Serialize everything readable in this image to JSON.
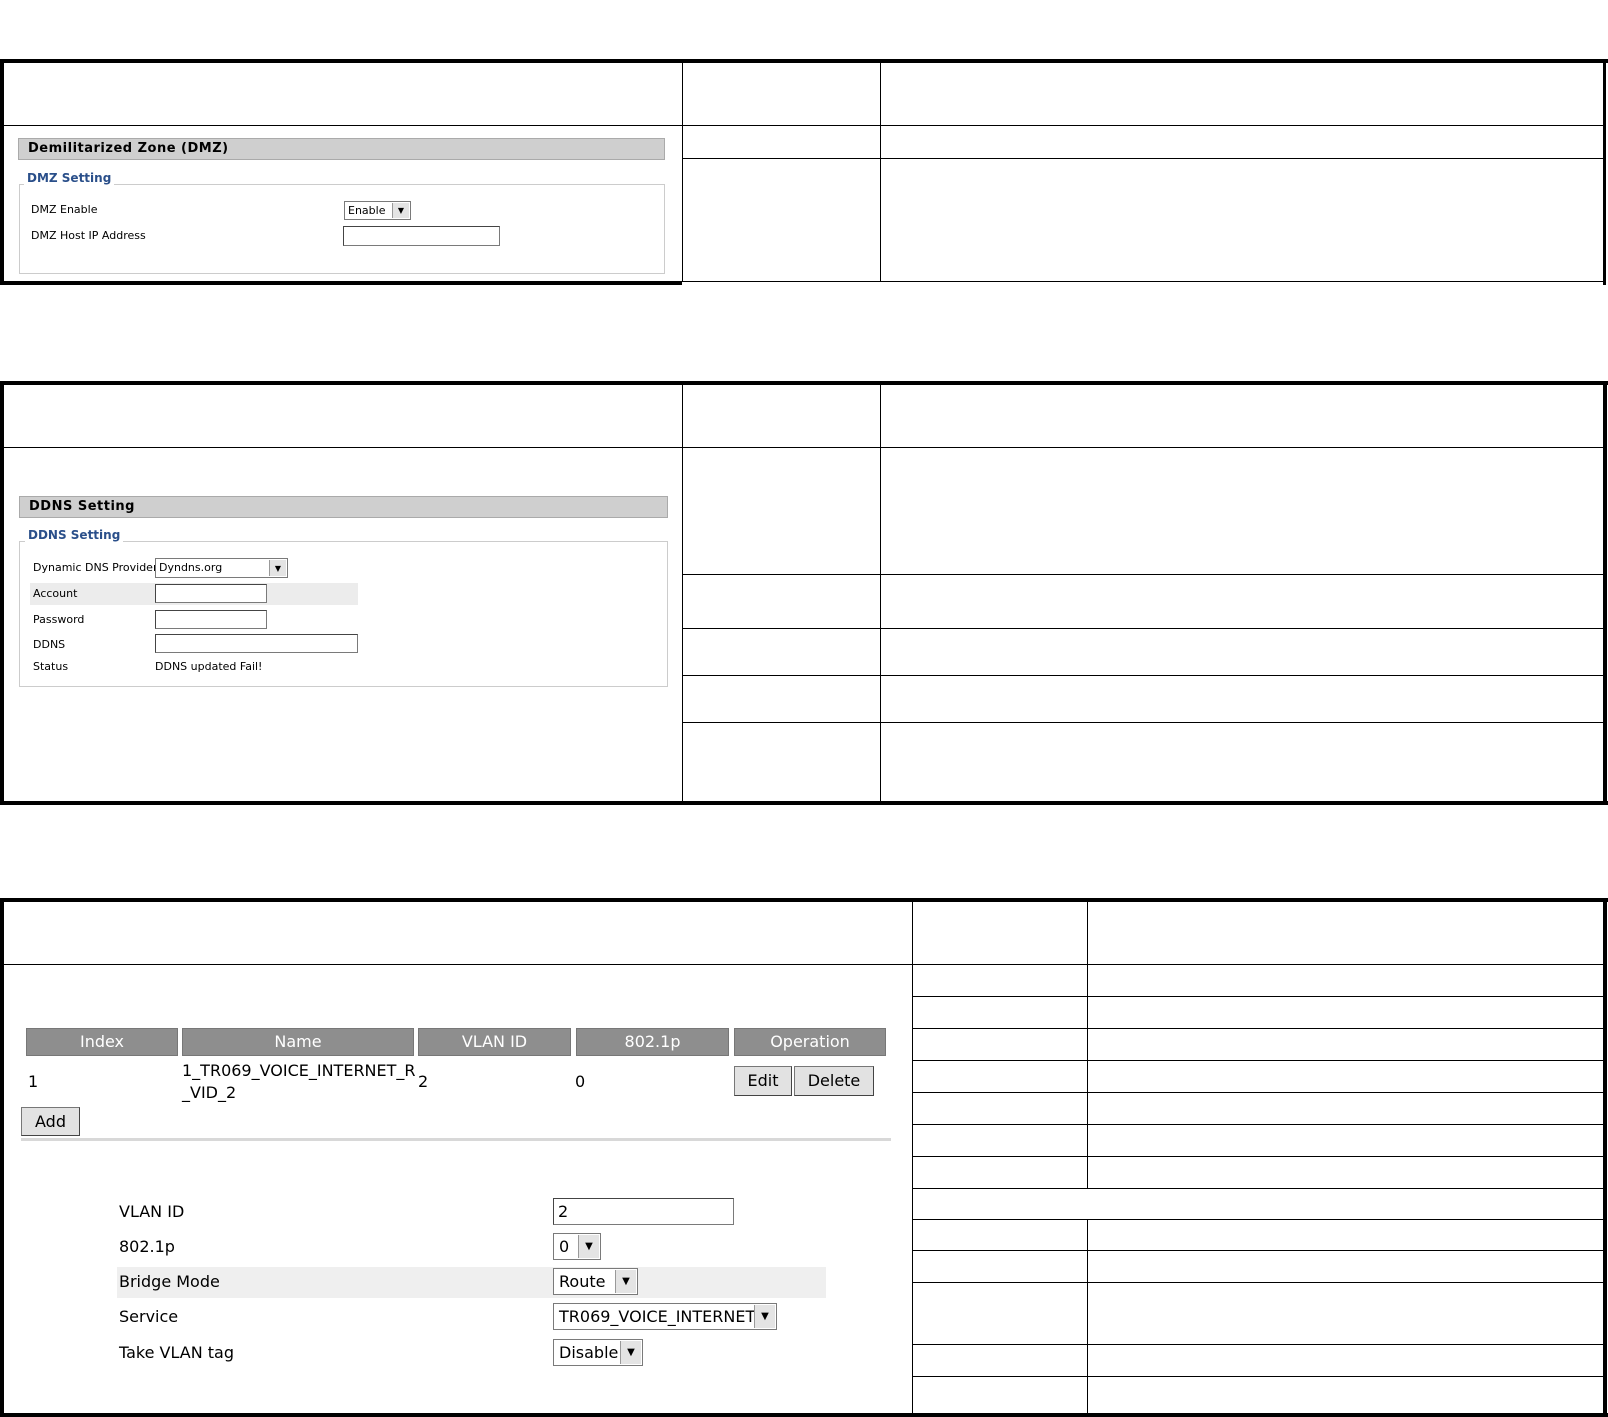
{
  "dmz": {
    "section_title": "Demilitarized Zone (DMZ)",
    "legend": "DMZ Setting",
    "enable_label": "DMZ Enable",
    "enable_value": "Enable",
    "host_ip_label": "DMZ Host IP Address",
    "host_ip_value": ""
  },
  "ddns": {
    "section_title": "DDNS Setting",
    "legend": "DDNS Setting",
    "provider_label": "Dynamic DNS Provider",
    "provider_value": "Dyndns.org",
    "account_label": "Account",
    "account_value": "",
    "password_label": "Password",
    "password_value": "",
    "ddns_label": "DDNS",
    "ddns_value": "",
    "status_label": "Status",
    "status_value": "DDNS updated Fail!"
  },
  "vlan": {
    "headers": [
      "Index",
      "Name",
      "VLAN ID",
      "802.1p",
      "Operation"
    ],
    "row": {
      "index": "1",
      "name_line1": "1_TR069_VOICE_INTERNET_R",
      "name_line2": "_VID_2",
      "vlan_id": "2",
      "p8021": "0",
      "edit_label": "Edit",
      "delete_label": "Delete"
    },
    "add_label": "Add",
    "form": {
      "vlan_id_label": "VLAN ID",
      "vlan_id_value": "2",
      "p8021_label": "802.1p",
      "p8021_value": "0",
      "bridge_mode_label": "Bridge Mode",
      "bridge_mode_value": "Route",
      "service_label": "Service",
      "service_value": "TR069_VOICE_INTERNET",
      "take_vlan_tag_label": "Take VLAN tag",
      "take_vlan_tag_value": "Disable"
    }
  },
  "icons": {
    "dropdown": "chevron-down-icon"
  }
}
